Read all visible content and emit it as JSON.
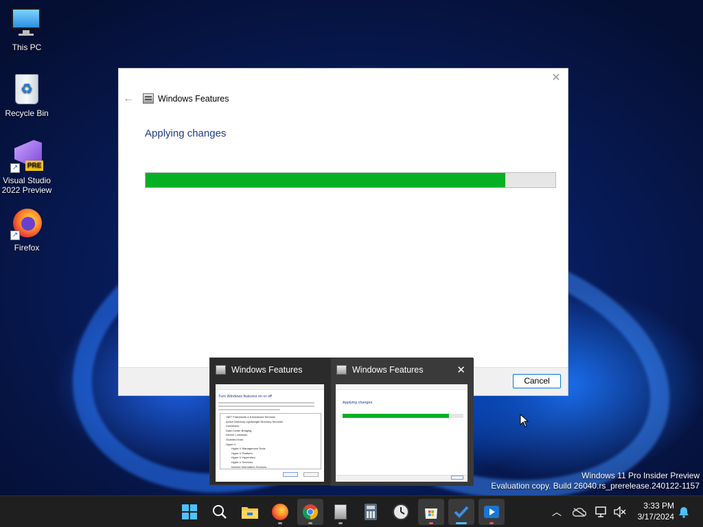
{
  "desktop": {
    "icons": [
      {
        "label": "This PC"
      },
      {
        "label": "Recycle Bin"
      },
      {
        "label": "Visual Studio\n2022 Preview",
        "line1": "Visual Studio",
        "line2": "2022 Preview",
        "badge": "PRE"
      },
      {
        "label": "Firefox"
      }
    ]
  },
  "dialog": {
    "title": "Windows Features",
    "heading": "Applying changes",
    "progress_fraction": 0.877,
    "cancel_label": "Cancel",
    "progress_color": "#06b025"
  },
  "preview": {
    "thumb1_title": "Windows Features",
    "thumb2_title": "Windows Features",
    "thumb1_heading": "Turn Windows features on or off",
    "thumb1_items": [
      ".NET Framework 4.8 Advanced Services",
      "Active Directory Lightweight Directory Services",
      "Containers",
      "Data Center Bridging",
      "Device Lockdown",
      "Guarded Host",
      "Hyper-V",
      "Hyper-V Management Tools",
      "Hyper-V Platform",
      "Hyper-V Hypervisor",
      "Hyper-V Services",
      "Internet Information Services"
    ],
    "thumb2_heading": "Applying changes",
    "thumb2_progress_fraction": 0.88
  },
  "watermark": {
    "line1": "Windows 11 Pro Insider Preview",
    "line2": "Evaluation copy. Build 26040.rs_prerelease.240122-1157"
  },
  "taskbar": {
    "apps": [
      "start-icon",
      "search-icon",
      "file-explorer-icon",
      "firefox-icon",
      "chrome-icon",
      "windows-features-icon",
      "calculator-icon",
      "clock-icon",
      "microsoft-store-icon",
      "todo-icon",
      "media-player-icon"
    ],
    "time": "3:33 PM",
    "date": "3/17/2024"
  },
  "colors": {
    "accent": "#0078d4",
    "heading_blue": "#1f3a8a"
  }
}
